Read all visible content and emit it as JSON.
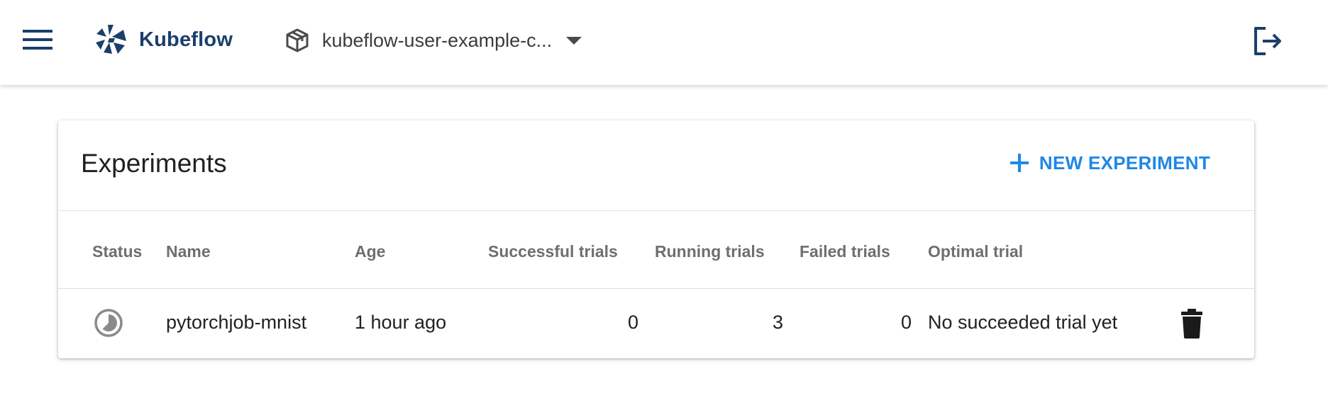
{
  "toolbar": {
    "menu_icon": "hamburger-menu-icon",
    "brand_name": "Kubeflow",
    "brand_color": "#1b3f6b",
    "namespace_icon": "box-icon",
    "namespace": "kubeflow-user-example-c...",
    "logout_icon": "logout-icon"
  },
  "experiments": {
    "title": "Experiments",
    "new_button_label": "NEW EXPERIMENT",
    "accent_color": "#1e88e5",
    "columns": [
      "Status",
      "Name",
      "Age",
      "Successful trials",
      "Running trials",
      "Failed trials",
      "Optimal trial"
    ],
    "rows": [
      {
        "status_icon": "running-clock-icon",
        "name": "pytorchjob-mnist",
        "age": "1 hour ago",
        "successful": "0",
        "running": "3",
        "failed": "0",
        "optimal": "No succeeded trial yet",
        "delete_icon": "trash-icon"
      }
    ]
  }
}
